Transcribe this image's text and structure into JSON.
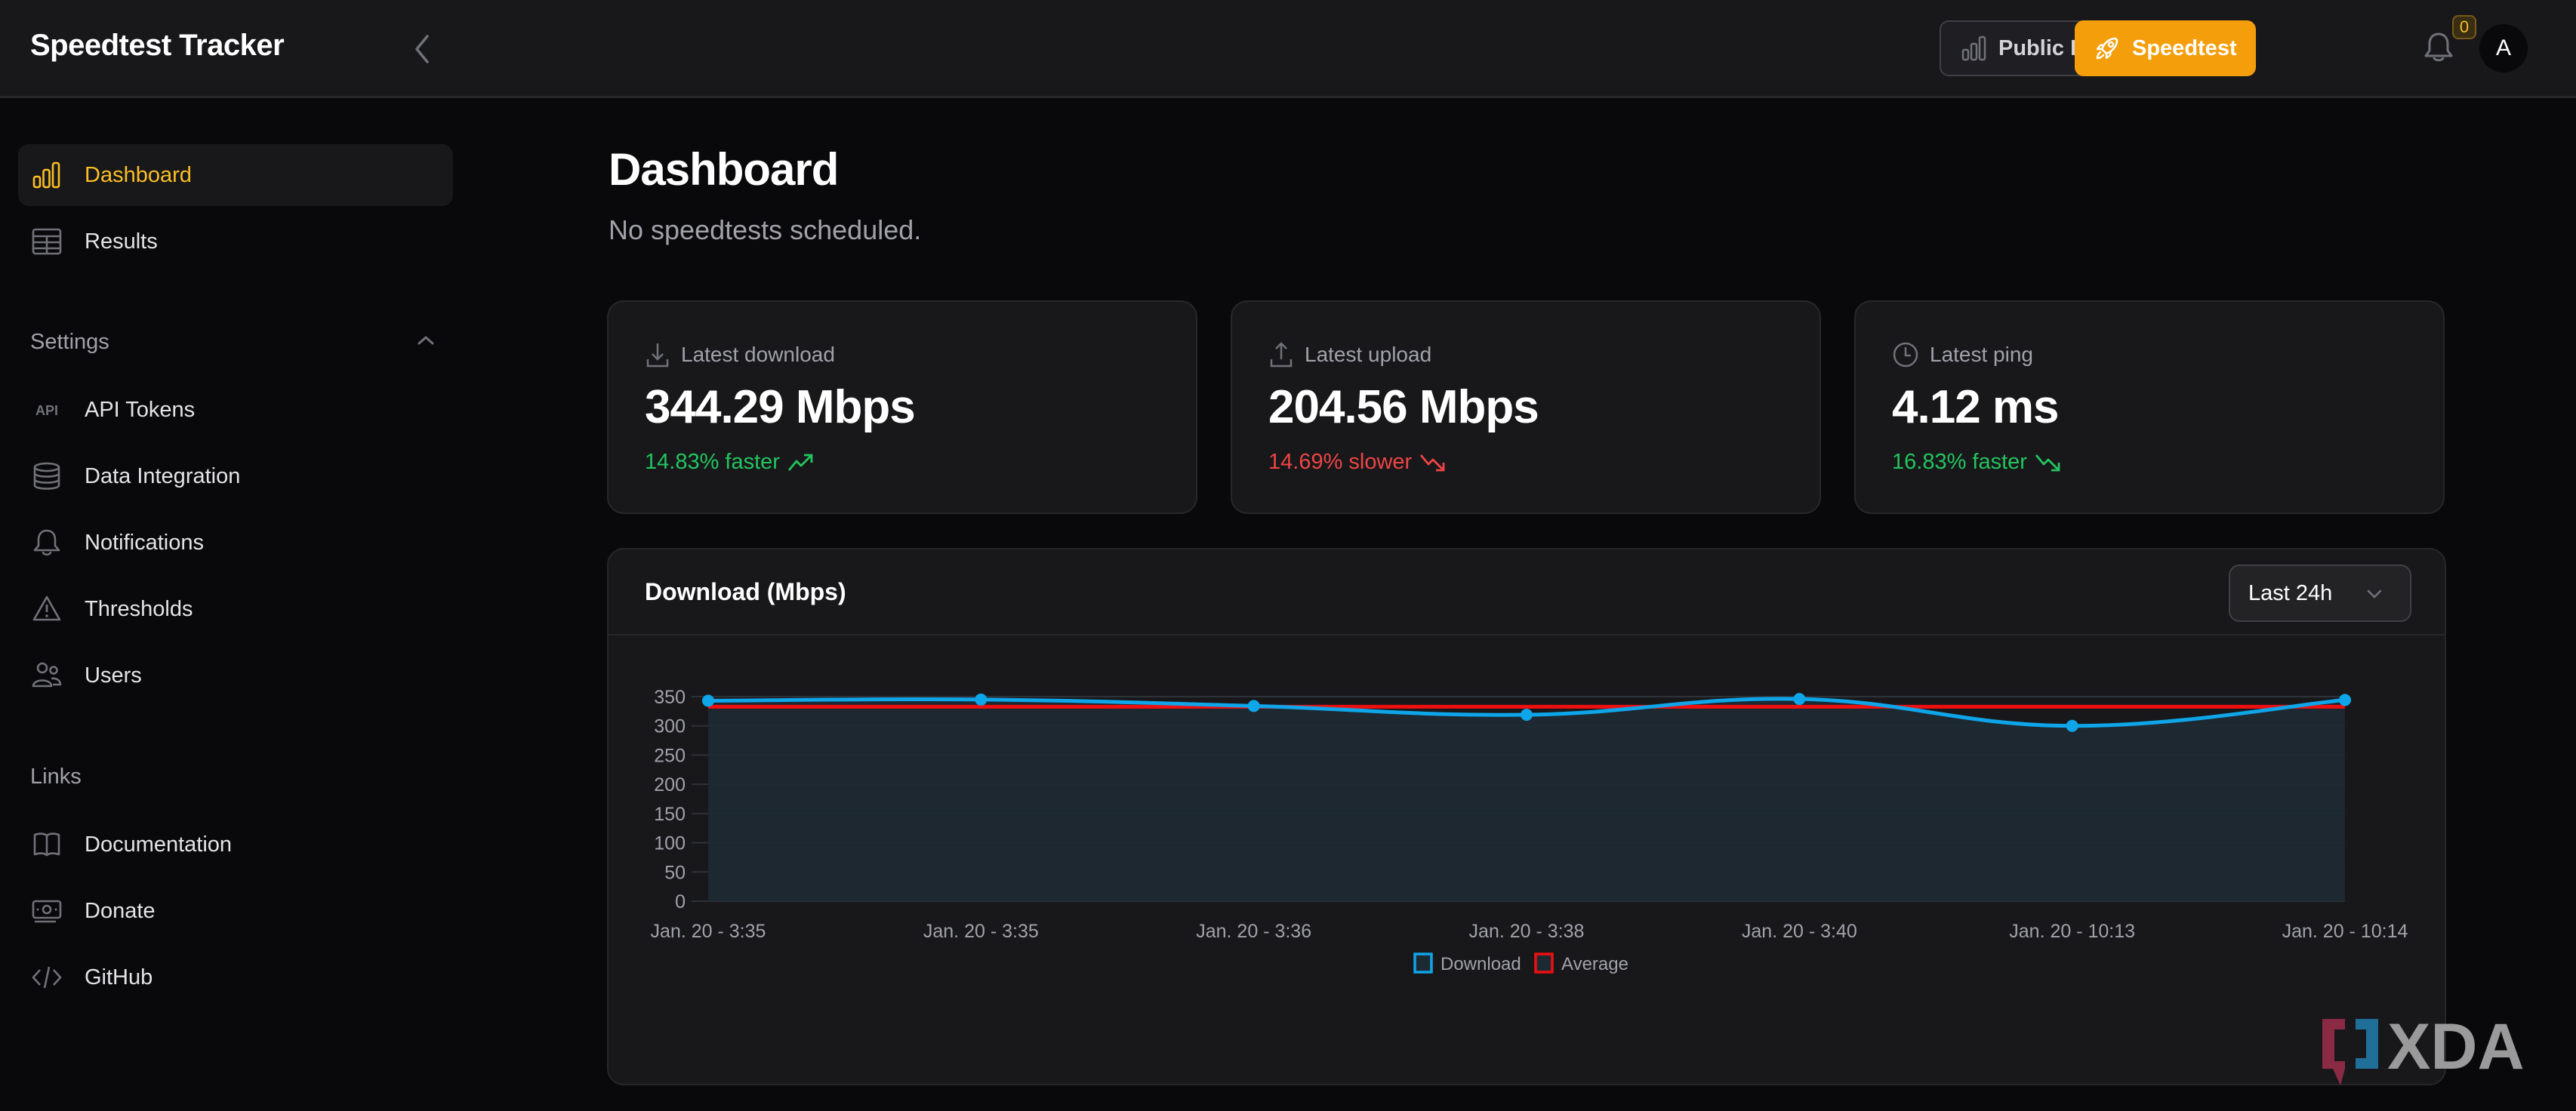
{
  "app": {
    "title": "Speedtest Tracker"
  },
  "header": {
    "public_dashboard_label": "Public Dashboard",
    "speedtest_label": "Speedtest",
    "notification_count": "0",
    "avatar_initial": "A",
    "accent_color": "#f59e0b"
  },
  "sidebar": {
    "items": [
      {
        "label": "Dashboard",
        "icon": "bar-chart-icon",
        "active": true
      },
      {
        "label": "Results",
        "icon": "table-icon",
        "active": false
      }
    ],
    "settings_label": "Settings",
    "settings_items": [
      {
        "label": "API Tokens",
        "icon": "api-icon"
      },
      {
        "label": "Data Integration",
        "icon": "database-icon"
      },
      {
        "label": "Notifications",
        "icon": "bell-icon"
      },
      {
        "label": "Thresholds",
        "icon": "warning-triangle-icon"
      },
      {
        "label": "Users",
        "icon": "users-icon"
      }
    ],
    "links_label": "Links",
    "links_items": [
      {
        "label": "Documentation",
        "icon": "book-open-icon"
      },
      {
        "label": "Donate",
        "icon": "banknotes-icon"
      },
      {
        "label": "GitHub",
        "icon": "code-bracket-icon"
      }
    ]
  },
  "main": {
    "title": "Dashboard",
    "subtitle": "No speedtests scheduled.",
    "stats": [
      {
        "label": "Latest download",
        "value": "344.29 Mbps",
        "delta": "14.83% faster",
        "trend": "up",
        "status": "good",
        "icon": "download-icon"
      },
      {
        "label": "Latest upload",
        "value": "204.56 Mbps",
        "delta": "14.69% slower",
        "trend": "down",
        "status": "bad",
        "icon": "upload-icon"
      },
      {
        "label": "Latest ping",
        "value": "4.12 ms",
        "delta": "16.83% faster",
        "trend": "down",
        "status": "good",
        "icon": "clock-icon"
      }
    ],
    "chart_card": {
      "title": "Download (Mbps)",
      "range_selected": "Last 24h"
    }
  },
  "chart_data": {
    "type": "line",
    "title": "Download (Mbps)",
    "xlabel": "",
    "ylabel": "",
    "categories": [
      "Jan. 20 - 3:35",
      "Jan. 20 - 3:35",
      "Jan. 20 - 3:36",
      "Jan. 20 - 3:38",
      "Jan. 20 - 3:40",
      "Jan. 20 - 10:13",
      "Jan. 20 - 10:14"
    ],
    "series": [
      {
        "name": "Download",
        "color": "#0ea5e9",
        "fill": true,
        "values": [
          343,
          345,
          334,
          319,
          346,
          300,
          344.29
        ]
      },
      {
        "name": "Average",
        "color": "#ef0f0f",
        "fill": false,
        "values": [
          332.7,
          332.7,
          332.7,
          332.7,
          332.7,
          332.7,
          332.7
        ]
      }
    ],
    "yticks": [
      0,
      50,
      100,
      150,
      200,
      250,
      300,
      350
    ],
    "ylim": [
      0,
      350
    ],
    "grid": true,
    "legend": "bottom-center"
  },
  "watermark": {
    "text": "XDA"
  }
}
